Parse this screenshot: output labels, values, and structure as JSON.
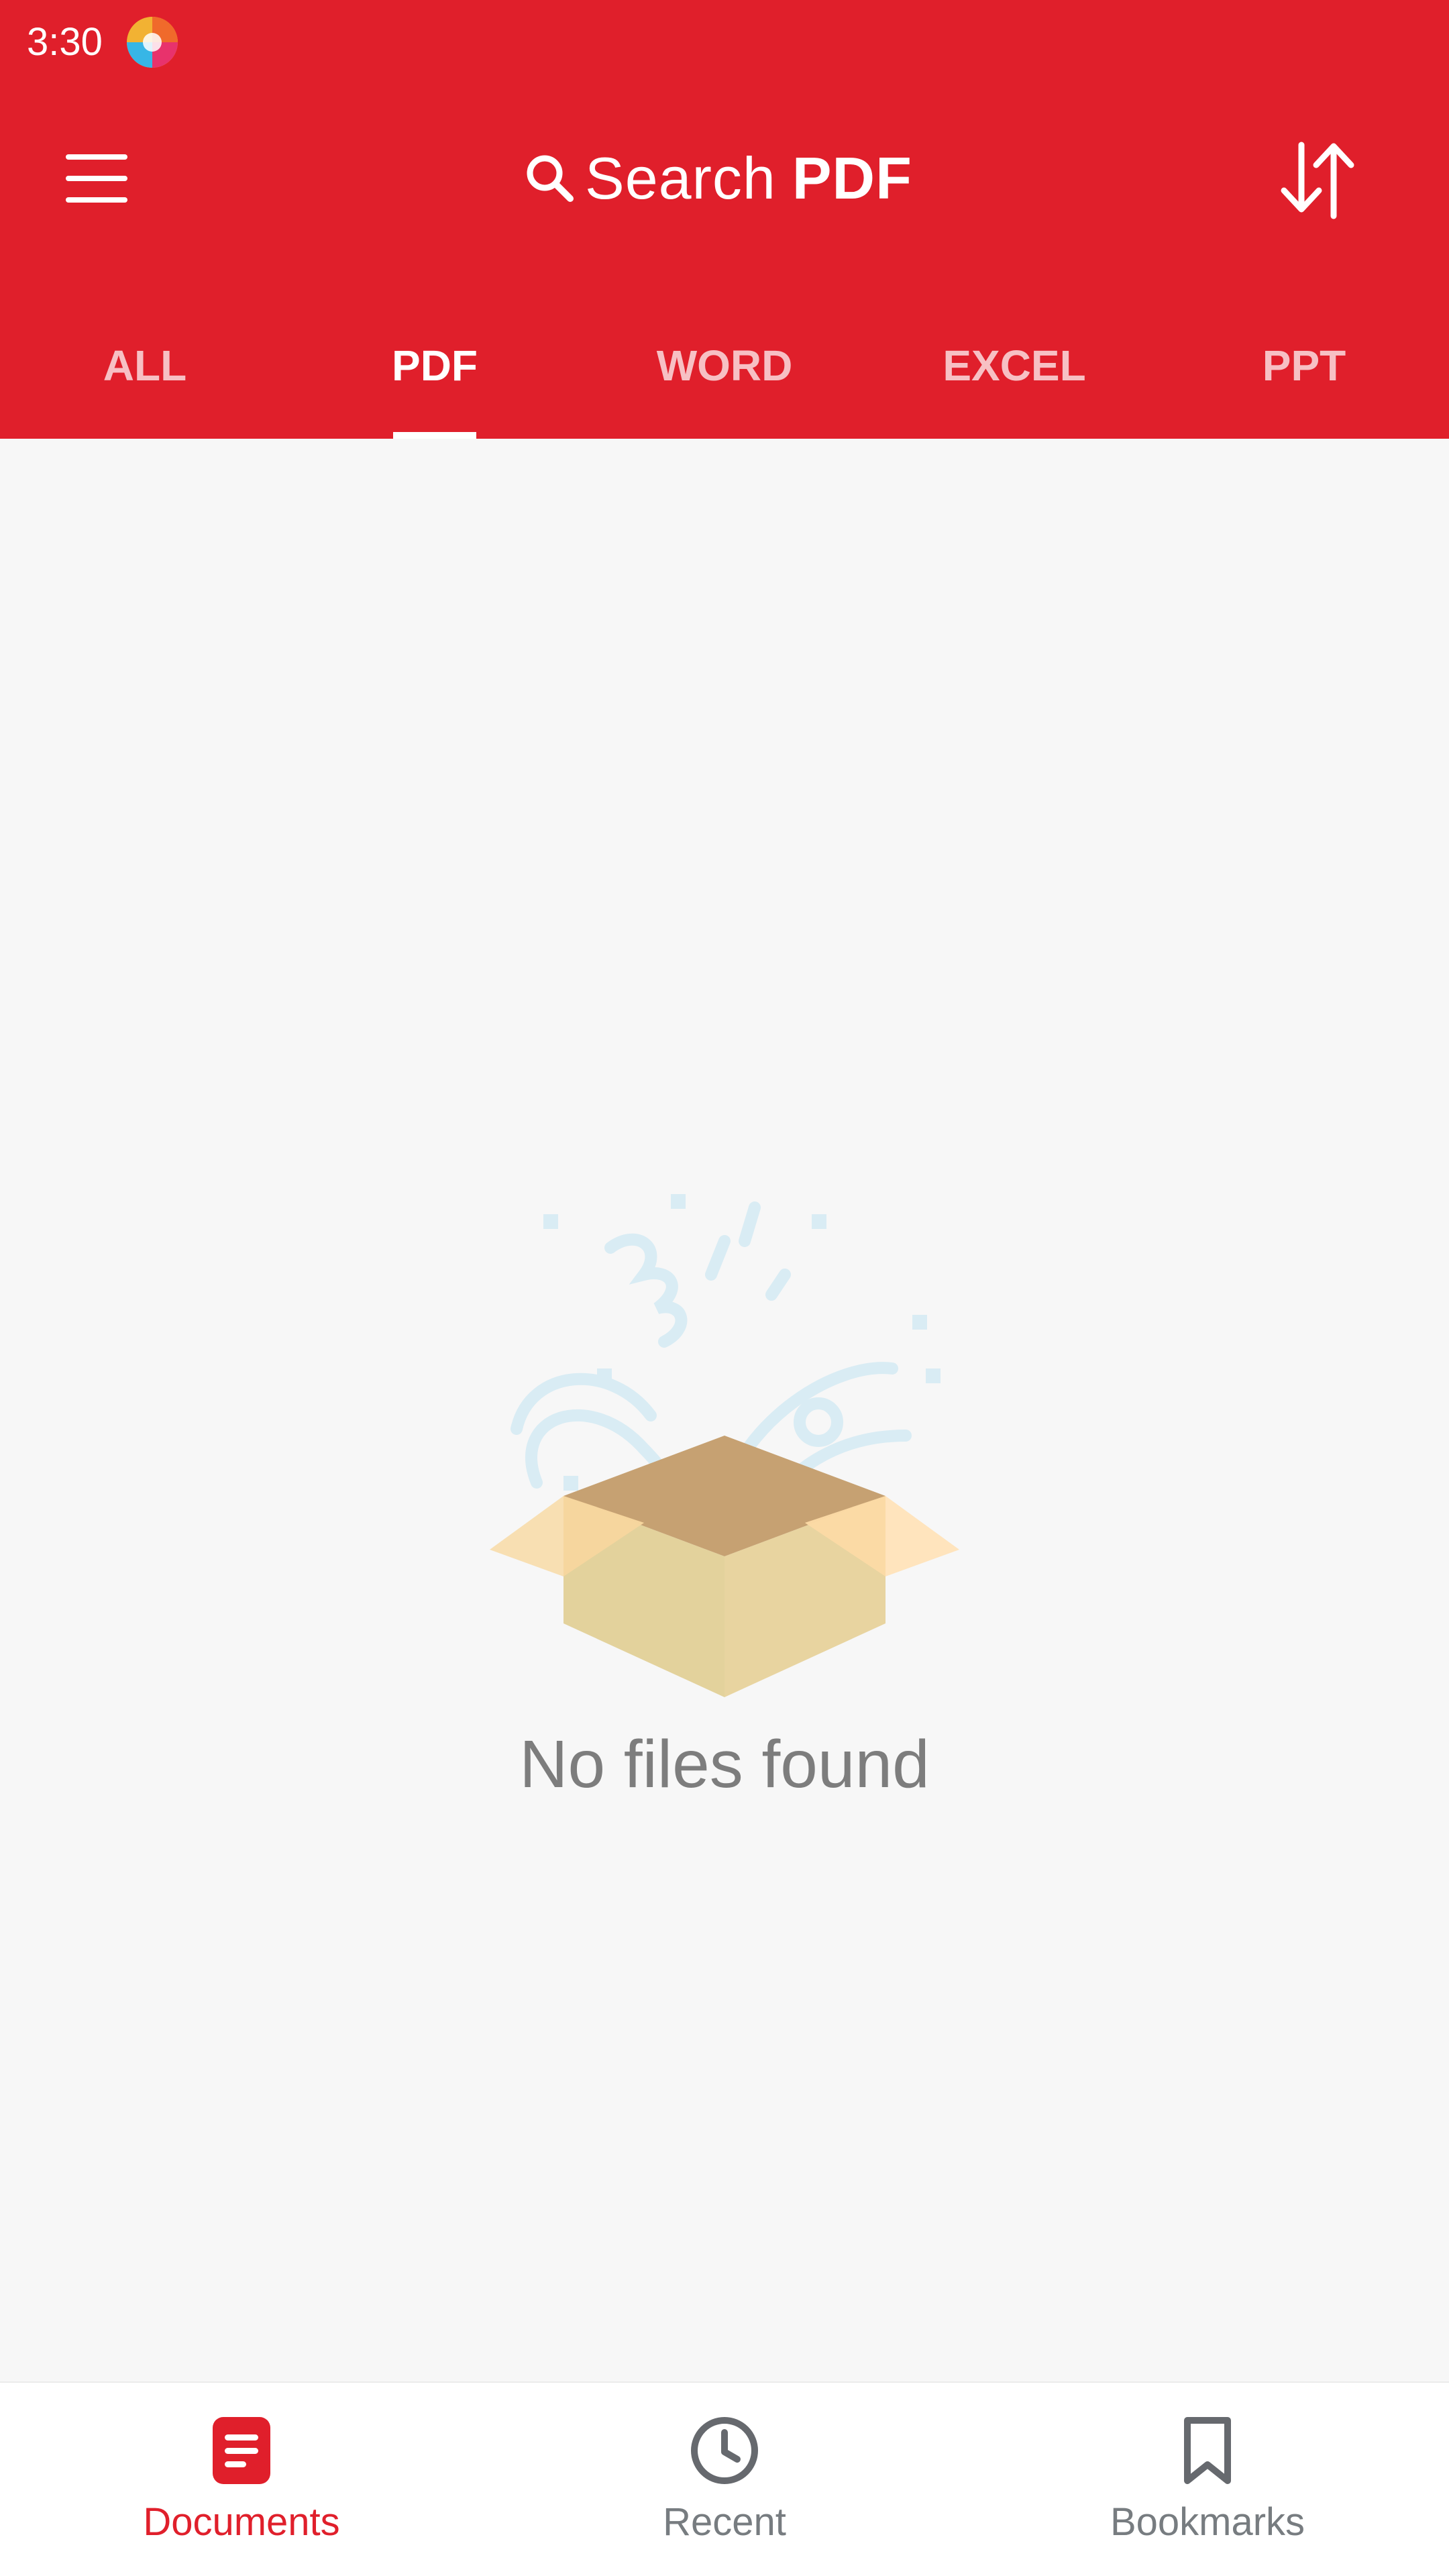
{
  "status_bar": {
    "time": "3:30"
  },
  "toolbar": {
    "search_word": "Search",
    "search_type": "PDF"
  },
  "tabs": [
    {
      "label": "ALL",
      "active": false
    },
    {
      "label": "PDF",
      "active": true
    },
    {
      "label": "WORD",
      "active": false
    },
    {
      "label": "EXCEL",
      "active": false
    },
    {
      "label": "PPT",
      "active": false
    }
  ],
  "empty_state": {
    "message": "No files found"
  },
  "bottom_nav": {
    "items": [
      {
        "label": "Documents",
        "icon": "document-icon",
        "active": true
      },
      {
        "label": "Recent",
        "icon": "clock-icon",
        "active": false
      },
      {
        "label": "Bookmarks",
        "icon": "bookmark-icon",
        "active": false
      }
    ]
  },
  "colors": {
    "primary": "#e01f2b",
    "background": "#f7f7f7",
    "inactive_nav": "#777c80",
    "empty_text": "#7d7d7d"
  },
  "icons": {
    "menu": "hamburger-menu-icon",
    "search": "search-icon",
    "sort": "sort-arrows-icon",
    "status_app": "app-logo-icon",
    "empty": "open-box-icon"
  }
}
